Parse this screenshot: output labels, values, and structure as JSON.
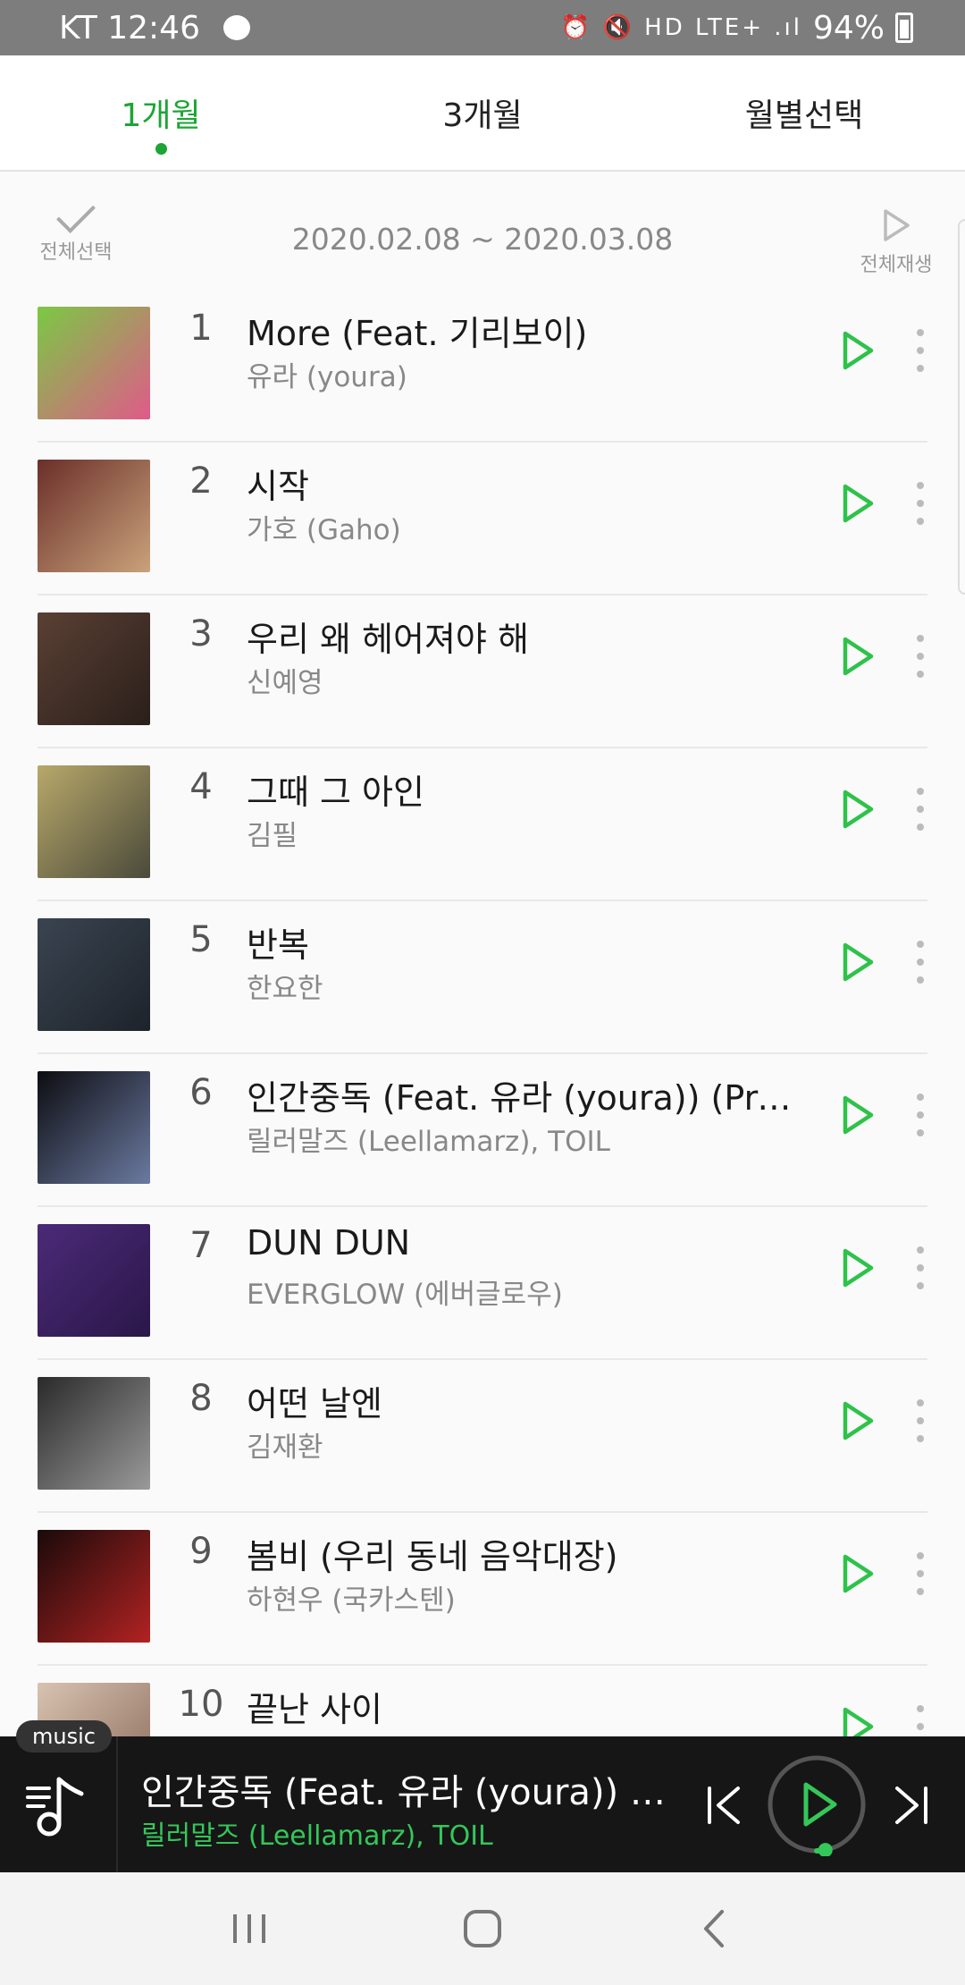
{
  "status_bar": {
    "carrier_time": "KT 12:46",
    "icons": "⏰ 🔇 HD LTE+ .ıl",
    "battery": "94%"
  },
  "tabs": [
    {
      "label": "1개월",
      "active": true
    },
    {
      "label": "3개월",
      "active": false
    },
    {
      "label": "월별선택",
      "active": false
    }
  ],
  "list_header": {
    "select_all_label": "전체선택",
    "date_range": "2020.02.08 ~ 2020.03.08",
    "play_all_label": "전체재생"
  },
  "songs": [
    {
      "rank": "1",
      "title": "More (Feat. 기리보이)",
      "artist": "유라 (youra)",
      "art_colors": [
        "#7ac943",
        "#e05a8a"
      ]
    },
    {
      "rank": "2",
      "title": "시작",
      "artist": "가호 (Gaho)",
      "art_colors": [
        "#6b2f2a",
        "#c9a27a"
      ]
    },
    {
      "rank": "3",
      "title": "우리 왜 헤어져야 해",
      "artist": "신예영",
      "art_colors": [
        "#5a4034",
        "#2a1f1a"
      ]
    },
    {
      "rank": "4",
      "title": "그때 그 아인",
      "artist": "김필",
      "art_colors": [
        "#b8a86a",
        "#4a4a3a"
      ]
    },
    {
      "rank": "5",
      "title": "반복",
      "artist": "한요한",
      "art_colors": [
        "#3a4450",
        "#1d232b"
      ]
    },
    {
      "rank": "6",
      "title": "인간중독 (Feat. 유라 (youra)) (Prod. TOIL)",
      "artist": "릴러말즈 (Leellamarz), TOIL",
      "art_colors": [
        "#0d0d12",
        "#6a7aa0"
      ]
    },
    {
      "rank": "7",
      "title": "DUN DUN",
      "artist": "EVERGLOW (에버글로우)",
      "art_colors": [
        "#4b2a78",
        "#2a1748"
      ]
    },
    {
      "rank": "8",
      "title": "어떤 날엔",
      "artist": "김재환",
      "art_colors": [
        "#2a2a2a",
        "#9a9a9a"
      ]
    },
    {
      "rank": "9",
      "title": "봄비 (우리 동네 음악대장)",
      "artist": "하현우 (국카스텐)",
      "art_colors": [
        "#1a0a0a",
        "#b22222"
      ]
    },
    {
      "rank": "10",
      "title": "끝난 사이",
      "artist": "",
      "art_colors": [
        "#d8c3b0",
        "#8a6a5a"
      ]
    }
  ],
  "colors": {
    "accent": "#1ca535",
    "play_icon": "#2ec24a",
    "player_bg": "#161616"
  },
  "mini_player": {
    "badge": "music",
    "title": "인간중독 (Feat. 유라 (youra)) (Prod. TOIL)",
    "artist": "릴러말즈 (Leellamarz), TOIL",
    "progress": 0.03
  },
  "nav_bar": {
    "buttons": [
      "recent-apps",
      "home",
      "back"
    ]
  }
}
